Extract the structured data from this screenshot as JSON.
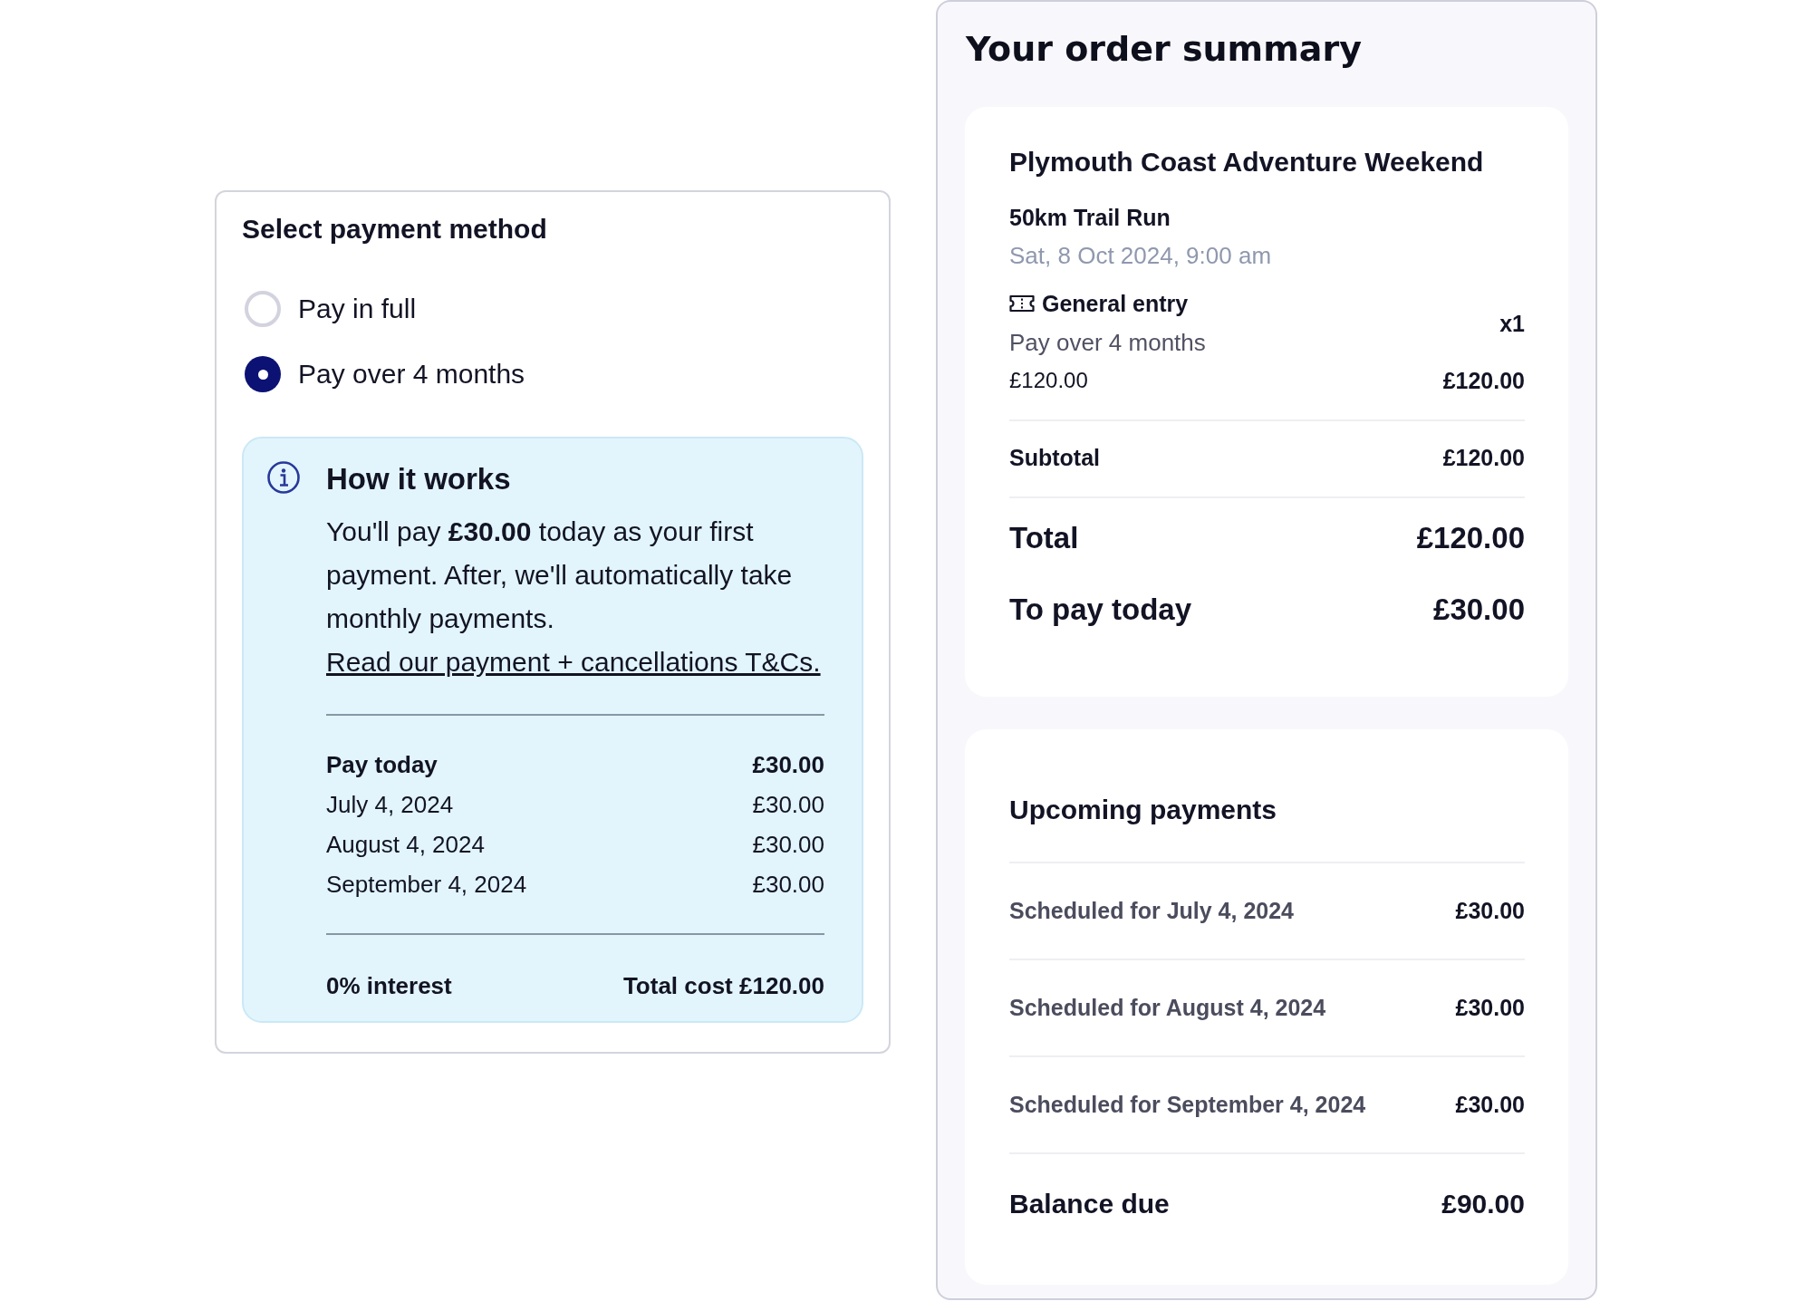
{
  "payment_method": {
    "title": "Select payment method",
    "options": [
      {
        "label": "Pay in full",
        "selected": false
      },
      {
        "label": "Pay over 4 months",
        "selected": true
      }
    ],
    "how_it_works": {
      "title": "How it works",
      "text": "You'll pay **£30.00** today as your first payment. After, we'll automatically take monthly payments.",
      "link": "Read our payment + cancellations T&Cs.",
      "schedule": [
        {
          "kind": "today",
          "label": "Pay today",
          "amount": "£30.00"
        },
        {
          "kind": "scheduled",
          "label": "July 4, 2024",
          "amount": "£30.00"
        },
        {
          "kind": "scheduled",
          "label": "August 4, 2024",
          "amount": "£30.00"
        },
        {
          "kind": "scheduled",
          "label": "September 4, 2024",
          "amount": "£30.00"
        }
      ],
      "interest": "0% interest",
      "total_cost": "Total cost £120.00"
    }
  },
  "order_summary": {
    "title": "Your order summary",
    "event": {
      "name": "Plymouth Coast Adventure Weekend",
      "session": "50km Trail Run",
      "date": "Sat, 8 Oct 2024, 9:00 am"
    },
    "ticket": {
      "name": "General entry",
      "plan": "Pay over 4 months",
      "quantity": "x1",
      "unit_price": "£120.00",
      "line_total": "£120.00"
    },
    "subtotal": {
      "label": "Subtotal",
      "amount": "£120.00"
    },
    "totals": [
      {
        "label": "Total",
        "amount": "£120.00"
      },
      {
        "label": "To pay today",
        "amount": "£30.00"
      }
    ]
  },
  "upcoming_payments": {
    "title": "Upcoming payments",
    "items": [
      {
        "label": "Scheduled for July 4, 2024",
        "amount": "£30.00"
      },
      {
        "label": "Scheduled for August 4, 2024",
        "amount": "£30.00"
      },
      {
        "label": "Scheduled for September 4, 2024",
        "amount": "£30.00"
      }
    ],
    "balance": {
      "label": "Balance due",
      "amount": "£90.00"
    }
  }
}
